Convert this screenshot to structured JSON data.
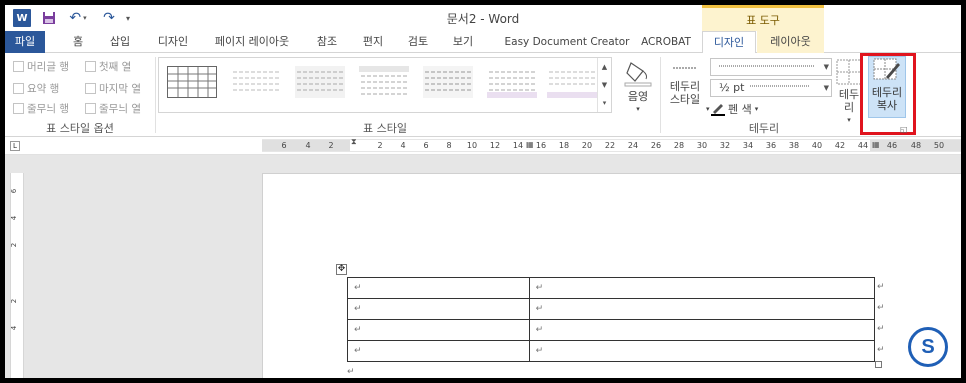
{
  "titlebar": {
    "title": "문서2 - Word",
    "app_badge": "W",
    "contextual_header": "표 도구"
  },
  "tabs": [
    {
      "label": "파일"
    },
    {
      "label": "홈"
    },
    {
      "label": "삽입"
    },
    {
      "label": "디자인"
    },
    {
      "label": "페이지 레이아웃"
    },
    {
      "label": "참조"
    },
    {
      "label": "편지"
    },
    {
      "label": "검토"
    },
    {
      "label": "보기"
    },
    {
      "label": "Easy Document Creator"
    },
    {
      "label": "ACROBAT"
    },
    {
      "label": "디자인",
      "active": true
    },
    {
      "label": "레이아웃"
    }
  ],
  "style_options": {
    "items": [
      {
        "label": "머리글 행"
      },
      {
        "label": "첫째 열"
      },
      {
        "label": "요약 행"
      },
      {
        "label": "마지막 열"
      },
      {
        "label": "줄무늬 행"
      },
      {
        "label": "줄무늬 열"
      }
    ],
    "group_label": "표 스타일 옵션"
  },
  "table_styles": {
    "group_label": "표 스타일",
    "shading_label": "음영"
  },
  "borders": {
    "border_styles_label_1": "테두리",
    "border_styles_label_2": "스타일",
    "line_weight": "½ pt",
    "pen_color_label": "펜 색",
    "borders_button": "테두리",
    "border_painter_line1": "테두리",
    "border_painter_line2": "복사",
    "group_label": "테두리"
  },
  "ruler": {
    "numbers": [
      "6",
      "4",
      "2",
      "2",
      "4",
      "6",
      "8",
      "10",
      "12",
      "14",
      "16",
      "18",
      "20",
      "22",
      "24",
      "26",
      "28",
      "30",
      "32",
      "34",
      "36",
      "38",
      "40",
      "42",
      "44",
      "46",
      "48",
      "50"
    ],
    "vertical_numbers": [
      "6",
      "4",
      "2",
      "2",
      "4"
    ]
  },
  "document": {
    "table_rows": [
      [
        "↵",
        "↵"
      ],
      [
        "↵",
        "↵"
      ],
      [
        "↵",
        "↵"
      ],
      [
        "↵",
        "↵"
      ]
    ],
    "row_end_mark": "↵",
    "paragraph_mark": "↵"
  },
  "colors": {
    "word_blue": "#2b579a",
    "contextual_tab": "#fdf3cf",
    "highlight_red": "#e0141e",
    "selected_button": "#cde3f7"
  }
}
